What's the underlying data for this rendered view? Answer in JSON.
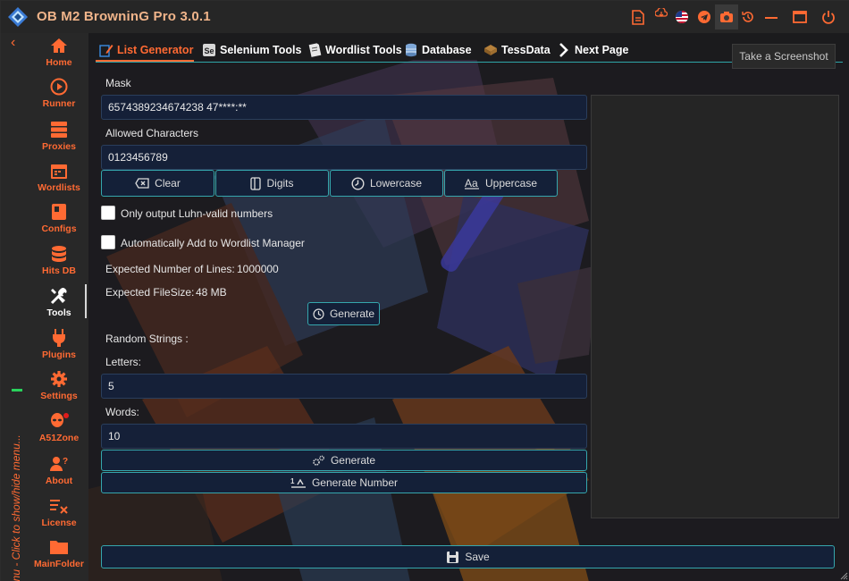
{
  "window": {
    "title": "OB M2 BrowninG Pro  3.0.1",
    "accent_color": "#ff6a33",
    "icons": [
      "document-icon",
      "cloud-download-icon",
      "us-flag-icon",
      "telegram-icon",
      "camera-icon",
      "history-icon",
      "minimize-icon",
      "maximize-icon",
      "power-icon"
    ]
  },
  "sidebar": {
    "items": [
      {
        "label": "Home",
        "icon": "home-icon"
      },
      {
        "label": "Runner",
        "icon": "play-icon"
      },
      {
        "label": "Proxies",
        "icon": "server-icon"
      },
      {
        "label": "Wordlists",
        "icon": "calendar-icon"
      },
      {
        "label": "Configs",
        "icon": "config-icon"
      },
      {
        "label": "Hits DB",
        "icon": "database-icon"
      },
      {
        "label": "Tools",
        "icon": "tools-icon"
      },
      {
        "label": "Plugins",
        "icon": "plug-icon"
      },
      {
        "label": "Settings",
        "icon": "gear-icon"
      },
      {
        "label": "A51Zone",
        "icon": "alien-icon"
      },
      {
        "label": "About",
        "icon": "user-question-icon"
      },
      {
        "label": "License",
        "icon": "license-icon"
      },
      {
        "label": "MainFolder",
        "icon": "folder-icon"
      }
    ],
    "active": "Tools",
    "vertical_text": "Menu - Click to show/hide menu..."
  },
  "tabs": [
    {
      "label": "List Generator",
      "icon": "list-edit-icon"
    },
    {
      "label": "Selenium Tools",
      "icon": "selenium-icon"
    },
    {
      "label": "Wordlist Tools",
      "icon": "wordlist-icon"
    },
    {
      "label": "Database",
      "icon": "database-icon"
    },
    {
      "label": "TessData",
      "icon": "tessdata-icon"
    },
    {
      "label": "Next Page",
      "icon": "chevron-right-icon"
    }
  ],
  "tooltip": "Take a Screenshot",
  "form": {
    "mask_label": "Mask",
    "mask_value": "6574389234674238 47****:**",
    "allowed_label": "Allowed Characters",
    "allowed_value": "0123456789",
    "buttons": {
      "clear": "Clear",
      "digits": "Digits",
      "lowercase": "Lowercase",
      "uppercase": "Uppercase"
    },
    "luhn_label": "Only output Luhn-valid numbers",
    "luhn_checked": false,
    "autoadd_label": "Automatically Add to Wordlist Manager",
    "autoadd_checked": false,
    "expected_lines_label": "Expected Number of Lines:",
    "expected_lines_value": "1000000",
    "expected_size_label": "Expected FileSize:",
    "expected_size_value": "48 MB",
    "generate_label": "Generate",
    "random_label": "Random Strings :",
    "letters_label": "Letters:",
    "letters_value": "5",
    "words_label": "Words:",
    "words_value": "10",
    "generate2_label": "Generate",
    "generate_number_label": "Generate Number",
    "save_label": "Save"
  }
}
